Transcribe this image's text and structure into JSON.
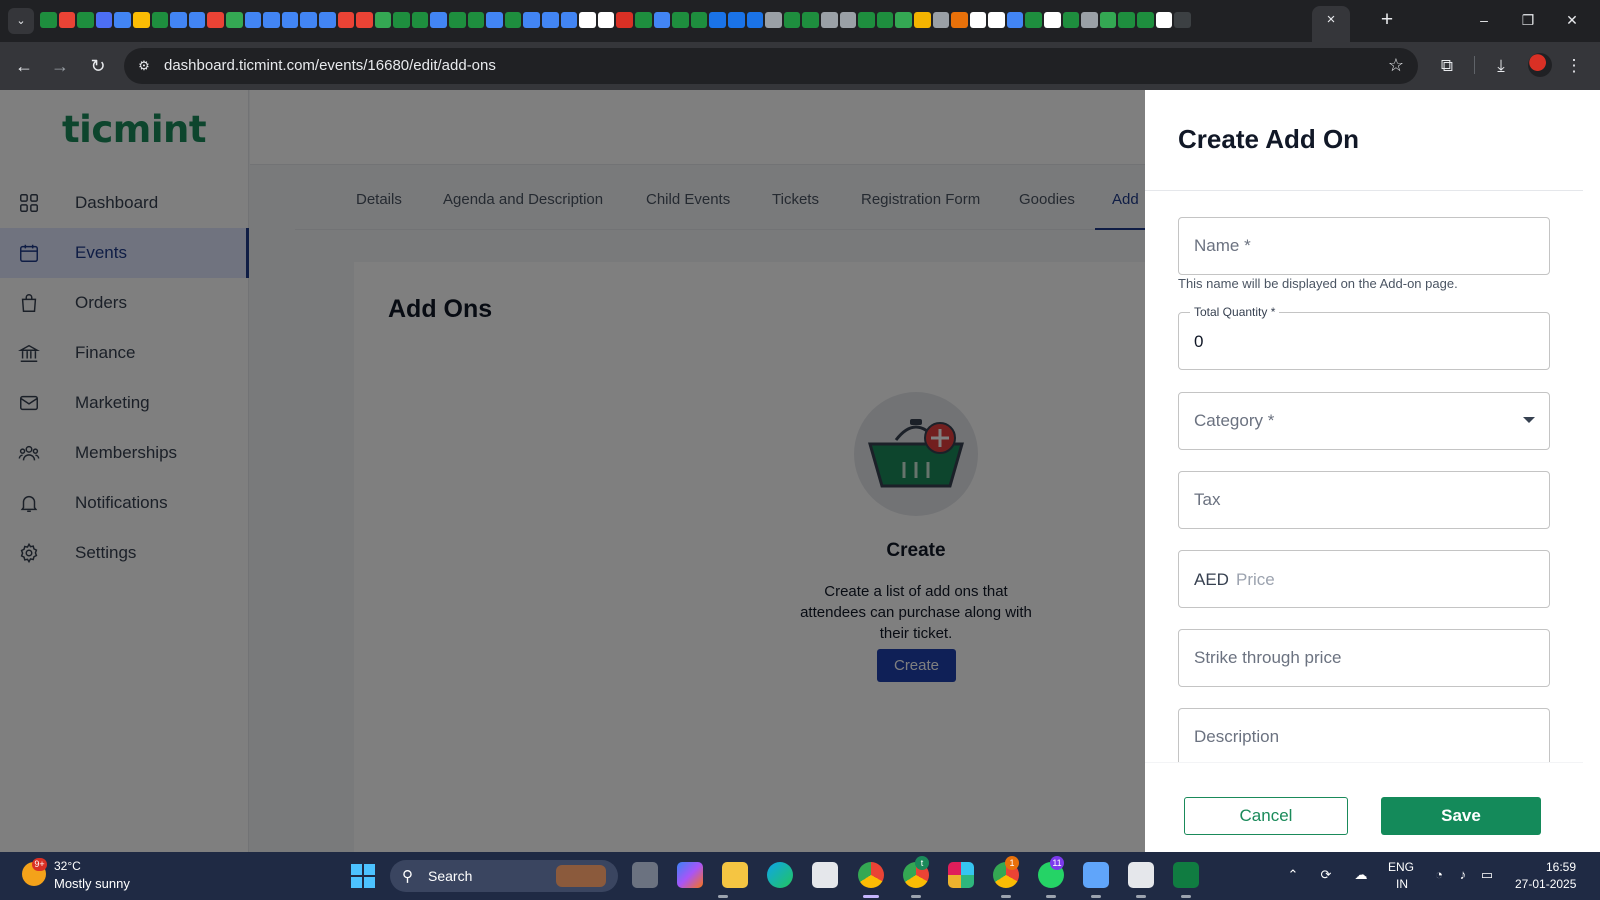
{
  "browser": {
    "tab_favicons": [
      "#1e8e3e",
      "#ea4335",
      "#1e8e3e",
      "#4c6ef5",
      "#4285f4",
      "#fbbc04",
      "#1e8e3e",
      "#4285f4",
      "#4285f4",
      "#ea4335",
      "#34a853",
      "#4285f4",
      "#4285f4",
      "#4285f4",
      "#4285f4",
      "#4285f4",
      "#ea4335",
      "#ea4335",
      "#34a853",
      "#1e8e3e",
      "#1e8e3e",
      "#4285f4",
      "#1e8e3e",
      "#1e8e3e",
      "#4285f4",
      "#1e8e3e",
      "#4285f4",
      "#4285f4",
      "#4285f4",
      "#ffffff",
      "#ffffff",
      "#d93025",
      "#1e8e3e",
      "#4285f4",
      "#1e8e3e",
      "#1e8e3e",
      "#1a73e8",
      "#1a73e8",
      "#1a73e8",
      "#9aa0a6",
      "#1e8e3e",
      "#1e8e3e",
      "#9aa0a6",
      "#9aa0a6",
      "#1e8e3e",
      "#1e8e3e",
      "#34a853",
      "#f4b400",
      "#9aa0a6",
      "#e8710a",
      "#ffffff",
      "#ffffff",
      "#4285f4",
      "#1e8e3e",
      "#ffffff",
      "#1e8e3e",
      "#9aa0a6",
      "#34a853",
      "#1e8e3e",
      "#1e8e3e",
      "#ffffff",
      "#3c4043"
    ],
    "tab_close_icon": "×",
    "new_tab_icon": "+",
    "url": "dashboard.ticmint.com/events/16680/edit/add-ons",
    "window_controls": {
      "minimize": "–",
      "maximize": "❐",
      "close": "✕"
    }
  },
  "app": {
    "logo": "ticmint",
    "nav": [
      {
        "label": "Dashboard",
        "icon": "grid-icon"
      },
      {
        "label": "Events",
        "icon": "calendar-icon",
        "active": true
      },
      {
        "label": "Orders",
        "icon": "bag-icon"
      },
      {
        "label": "Finance",
        "icon": "bank-icon"
      },
      {
        "label": "Marketing",
        "icon": "mail-icon"
      },
      {
        "label": "Memberships",
        "icon": "people-icon"
      },
      {
        "label": "Notifications",
        "icon": "bell-icon"
      },
      {
        "label": "Settings",
        "icon": "gear-icon"
      }
    ],
    "subtabs": [
      "Details",
      "Agenda and Description",
      "Child Events",
      "Tickets",
      "Registration Form",
      "Goodies",
      "Add"
    ],
    "card": {
      "title": "Add Ons",
      "empty_title": "Create",
      "empty_text": "Create a list of add ons that attendees can purchase along with their ticket.",
      "create_button": "Create"
    }
  },
  "drawer": {
    "title": "Create Add On",
    "name_label": "Name *",
    "name_helper": "This name will be displayed on the Add-on page.",
    "quantity_label": "Total Quantity *",
    "quantity_value": "0",
    "category_label": "Category *",
    "tax_label": "Tax",
    "currency_prefix": "AED",
    "price_placeholder": "Price",
    "strike_label": "Strike through price",
    "description_label": "Description",
    "cancel": "Cancel",
    "save": "Save"
  },
  "taskbar": {
    "weather_badge": "9+",
    "temp": "32°C",
    "condition": "Mostly sunny",
    "search": "Search",
    "badges": {
      "chrome_2": "t",
      "chrome_4": "1",
      "whatsapp": "11"
    },
    "lang_1": "ENG",
    "lang_2": "IN",
    "time": "16:59",
    "date": "27-01-2025"
  },
  "colors": {
    "brand_green": "#1a8a5a",
    "nav_active": "#1e3a8a",
    "create_button": "#1e40af"
  }
}
